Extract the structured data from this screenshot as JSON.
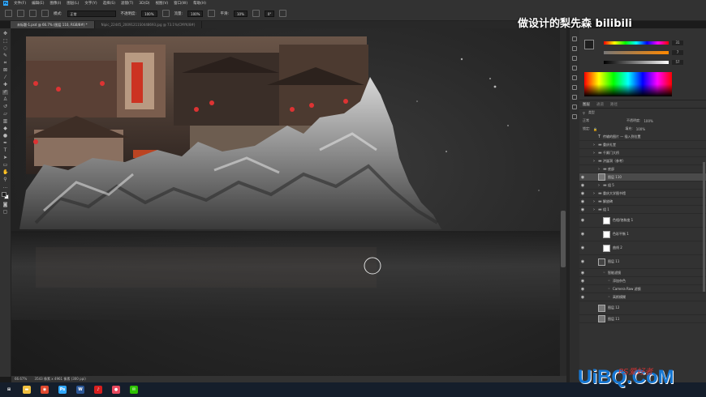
{
  "menu": [
    "Ps",
    "文件(F)",
    "编辑(E)",
    "图像(I)",
    "图层(L)",
    "文字(Y)",
    "选择(S)",
    "滤镜(T)",
    "3D(D)",
    "视图(V)",
    "窗口(W)",
    "帮助(H)"
  ],
  "options": {
    "mode_label": "模式:",
    "mode_value": "正常",
    "opacity_label": "不透明度:",
    "opacity_value": "100%",
    "flow_label": "流量:",
    "flow_value": "100%",
    "smooth_label": "平滑:",
    "smooth_value": "10%",
    "angle_value": "0°"
  },
  "tabs": [
    {
      "label": "未标题-1.psd @ 66.7% (图层 110, RGB/8#) *",
      "active": true
    },
    {
      "label": "Nipic_22445_20091211S0448693.jpg @ 73.1%(CMYK/8#)",
      "active": false
    }
  ],
  "status": {
    "zoom": "66.67%",
    "doc": "3543 像素 x 4961 像素 (300 ppi)"
  },
  "color_panel": {
    "values": [
      "31",
      "7",
      "57"
    ],
    "fg": "#1e1e1e",
    "bg": "#ffffff"
  },
  "layers_panel": {
    "tabs": [
      "图层",
      "通道",
      "路径"
    ],
    "filter_label": "类型",
    "blend_mode": "正常",
    "opacity_label": "不透明度:",
    "opacity": "100%",
    "lock_label": "锁定:",
    "fill_label": "填充:",
    "fill": "100%",
    "layers": [
      {
        "name": "传输的图片 — 插入到位置",
        "indent": 1,
        "type": "text",
        "eye": false
      },
      {
        "name": "重庆礼堂",
        "indent": 0,
        "type": "group",
        "eye": false
      },
      {
        "name": "千厮门大桥",
        "indent": 0,
        "type": "group",
        "eye": false
      },
      {
        "name": "洪崖洞（参考）",
        "indent": 0,
        "type": "group",
        "eye": false
      },
      {
        "name": "底部",
        "indent": 1,
        "type": "group",
        "eye": false
      },
      {
        "name": "图层 110",
        "indent": 1,
        "type": "layer",
        "eye": true,
        "selected": true
      },
      {
        "name": "组 5",
        "indent": 1,
        "type": "group",
        "eye": true
      },
      {
        "name": "重庆大学图书馆",
        "indent": 0,
        "type": "group",
        "eye": true
      },
      {
        "name": "解放碑",
        "indent": 0,
        "type": "group",
        "eye": true
      },
      {
        "name": "组 1",
        "indent": 0,
        "type": "group",
        "eye": true
      },
      {
        "name": "色相/饱和度 1",
        "indent": 2,
        "type": "adjust",
        "eye": true,
        "tall": true
      },
      {
        "name": "色彩平衡 1",
        "indent": 2,
        "type": "adjust",
        "eye": true,
        "tall": true
      },
      {
        "name": "曲线 2",
        "indent": 2,
        "type": "adjust",
        "eye": true,
        "tall": true
      },
      {
        "name": "图层 11",
        "indent": 1,
        "type": "smart",
        "eye": true,
        "tall": true
      },
      {
        "name": "智能滤镜",
        "indent": 2,
        "type": "sub",
        "eye": true
      },
      {
        "name": "添加杂色",
        "indent": 3,
        "type": "sub",
        "eye": true
      },
      {
        "name": "Camera Raw 滤镜",
        "indent": 3,
        "type": "sub",
        "eye": true
      },
      {
        "name": "高斯模糊",
        "indent": 3,
        "type": "sub",
        "eye": true
      },
      {
        "name": "图层 12",
        "indent": 1,
        "type": "layer",
        "eye": false,
        "tall": true
      },
      {
        "name": "图层 11",
        "indent": 1,
        "type": "layer",
        "eye": false
      }
    ]
  },
  "taskbar": [
    {
      "name": "start",
      "color": "#ffffff",
      "glyph": "⊞"
    },
    {
      "name": "explorer",
      "color": "#f0c040",
      "glyph": "▬"
    },
    {
      "name": "browser",
      "color": "#e04a2f",
      "glyph": "◉"
    },
    {
      "name": "photoshop",
      "color": "#31a8ff",
      "glyph": "Ps"
    },
    {
      "name": "word",
      "color": "#2b5797",
      "glyph": "W"
    },
    {
      "name": "netease-music",
      "color": "#d81e1e",
      "glyph": "♪"
    },
    {
      "name": "app",
      "color": "#e84a5f",
      "glyph": "●"
    },
    {
      "name": "wechat",
      "color": "#2dc100",
      "glyph": "✉"
    }
  ],
  "watermarks": {
    "bilibili": "做设计的梨先森 bilibili",
    "uibo": "UiBQ.CoM",
    "ps": "PS爱好者"
  }
}
